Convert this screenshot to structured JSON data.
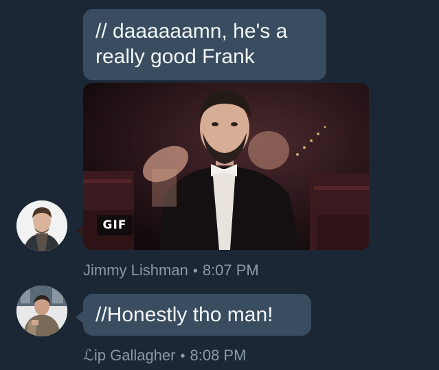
{
  "messages": [
    {
      "text": "// daaaaaamn, he's a really good Frank"
    },
    {
      "gif_label": "GIF",
      "sender": "Jimmy Lishman",
      "separator": "•",
      "time": "8:07 PM"
    },
    {
      "text": "//Honestly tho man!",
      "sender": "ℒip Gallagher",
      "separator": "•",
      "time": "8:08 PM"
    }
  ],
  "colors": {
    "background": "#1b2734",
    "bubble": "#3a4d60",
    "bubble_text": "#f3f6f9",
    "meta_text": "#8a99a8"
  }
}
